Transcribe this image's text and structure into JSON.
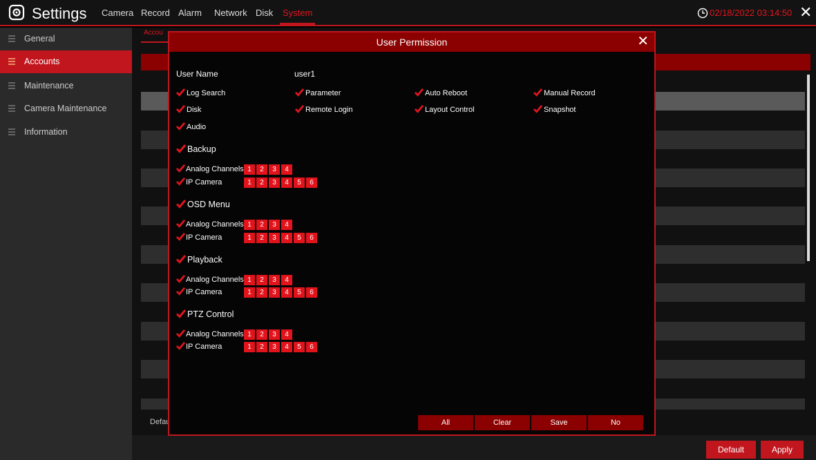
{
  "app": {
    "title": "Settings"
  },
  "nav": [
    "Camera",
    "Record",
    "Alarm",
    "Network",
    "Disk",
    "System"
  ],
  "datetime": "02/18/2022 03:14:50",
  "sidebar": {
    "items": [
      {
        "label": "General"
      },
      {
        "label": "Accounts"
      },
      {
        "label": "Maintenance"
      },
      {
        "label": "Camera Maintenance"
      },
      {
        "label": "Information"
      }
    ]
  },
  "subtab": "Accou",
  "background": {
    "default_label": "Defau"
  },
  "bottom": {
    "default": "Default",
    "apply": "Apply"
  },
  "dialog": {
    "title": "User Permission",
    "user_name_label": "User Name",
    "user_name_value": "user1",
    "permissions": [
      "Log Search",
      "Parameter",
      "Auto Reboot",
      "Manual Record",
      "Disk",
      "Remote Login",
      "Layout Control",
      "Snapshot",
      "Audio"
    ],
    "sections": [
      {
        "title": "Backup"
      },
      {
        "title": "OSD Menu"
      },
      {
        "title": "Playback"
      },
      {
        "title": "PTZ Control"
      }
    ],
    "analog_label": "Analog Channels",
    "ip_label": "IP Camera",
    "analog_channels": [
      "1",
      "2",
      "3",
      "4"
    ],
    "ip_channels": [
      "1",
      "2",
      "3",
      "4",
      "5",
      "6"
    ],
    "buttons": {
      "all": "All",
      "clear": "Clear",
      "save": "Save",
      "no": "No"
    }
  },
  "colors": {
    "accent": "#c1161e",
    "checkbox": "#e0161f",
    "title_bar": "#8b0000"
  }
}
